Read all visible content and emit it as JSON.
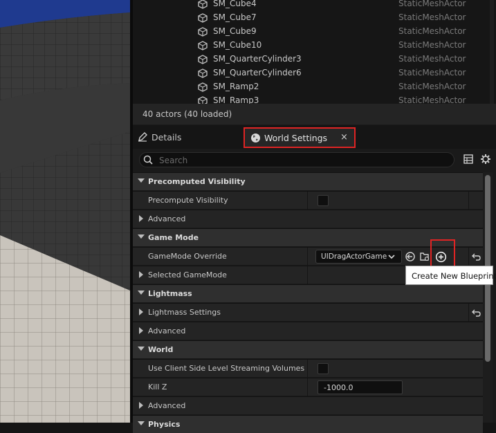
{
  "outliner": {
    "items": [
      {
        "name": "SM_Cube4",
        "type": "StaticMeshActor"
      },
      {
        "name": "SM_Cube7",
        "type": "StaticMeshActor"
      },
      {
        "name": "SM_Cube9",
        "type": "StaticMeshActor"
      },
      {
        "name": "SM_Cube10",
        "type": "StaticMeshActor"
      },
      {
        "name": "SM_QuarterCylinder3",
        "type": "StaticMeshActor"
      },
      {
        "name": "SM_QuarterCylinder6",
        "type": "StaticMeshActor"
      },
      {
        "name": "SM_Ramp2",
        "type": "StaticMeshActor"
      },
      {
        "name": "SM_Ramp3",
        "type": "StaticMeshActor"
      }
    ],
    "status": "40 actors (40 loaded)"
  },
  "tabs": {
    "details": "Details",
    "world_settings": "World Settings",
    "close_glyph": "×"
  },
  "search": {
    "placeholder": "Search"
  },
  "sections": {
    "precomputed_visibility": {
      "title": "Precomputed Visibility",
      "precompute_visibility": "Precompute Visibility",
      "advanced": "Advanced"
    },
    "game_mode": {
      "title": "Game Mode",
      "override_label": "GameMode Override",
      "override_value": "UIDragActorGame",
      "selected": "Selected GameMode"
    },
    "lightmass": {
      "title": "Lightmass",
      "settings": "Lightmass Settings",
      "advanced": "Advanced"
    },
    "world": {
      "title": "World",
      "client_streaming": "Use Client Side Level Streaming Volumes",
      "kill_z": "Kill Z",
      "kill_z_value": "-1000.0",
      "advanced": "Advanced",
      "next_title": "Physics"
    }
  },
  "tooltip": "Create New Blueprint",
  "colors": {
    "highlight": "#e02424",
    "panel": "#242424",
    "category": "#2f2f2f"
  }
}
